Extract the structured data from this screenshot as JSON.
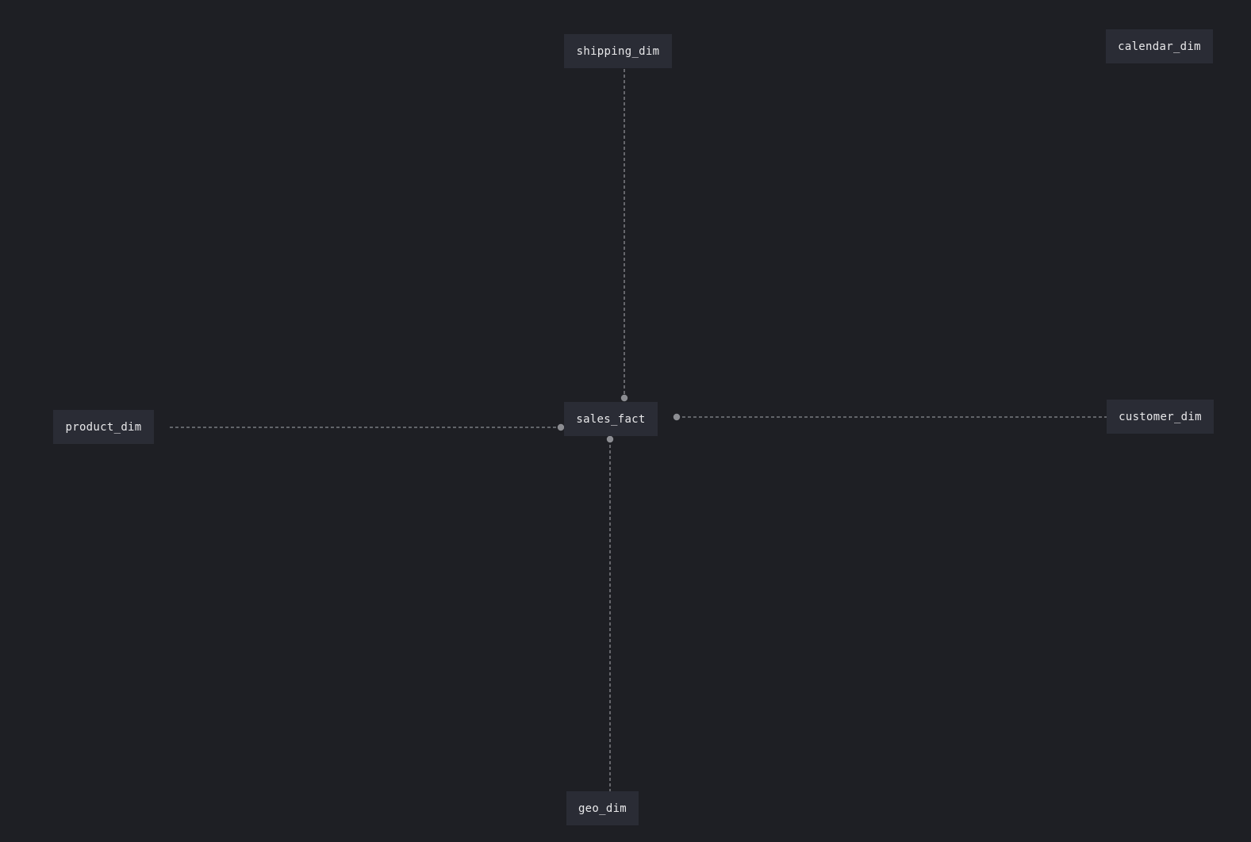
{
  "diagram": {
    "nodes": {
      "shipping": "shipping_dim",
      "calendar": "calendar_dim",
      "sales": "sales_fact",
      "product": "product_dim",
      "customer": "customer_dim",
      "geo": "geo_dim"
    },
    "edges": [
      {
        "from": "sales_fact",
        "to": "shipping_dim"
      },
      {
        "from": "sales_fact",
        "to": "product_dim"
      },
      {
        "from": "sales_fact",
        "to": "customer_dim"
      },
      {
        "from": "sales_fact",
        "to": "geo_dim"
      }
    ],
    "colors": {
      "background": "#1e1f24",
      "node_fill": "#2a2c35",
      "node_text": "#e8e8ea",
      "edge": "#8c8d92"
    }
  }
}
